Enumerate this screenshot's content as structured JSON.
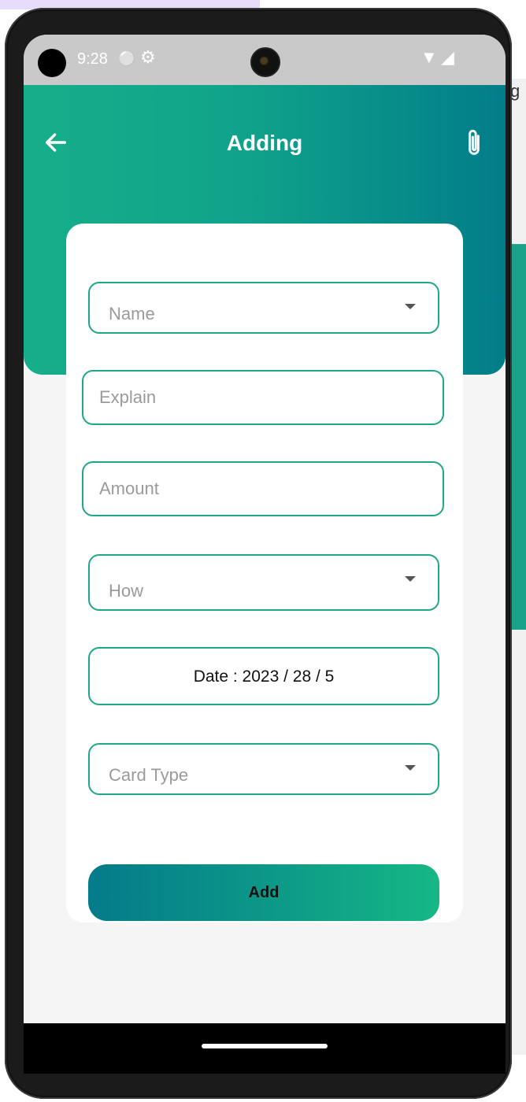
{
  "background": {
    "right_letter": "g"
  },
  "status_bar": {
    "time": "9:28",
    "icons": [
      "usb-icon",
      "settings-icon",
      "wifi-icon",
      "signal-icon"
    ]
  },
  "header": {
    "title": "Adding",
    "back_icon": "arrow-left-icon",
    "attach_icon": "paperclip-icon"
  },
  "form": {
    "name_dropdown": {
      "label": "Name"
    },
    "explain_input": {
      "placeholder": "Explain",
      "value": ""
    },
    "amount_input": {
      "placeholder": "Amount",
      "value": ""
    },
    "how_dropdown": {
      "label": "How"
    },
    "date_button": {
      "label": "Date : 2023 / 28 / 5"
    },
    "card_type_dropdown": {
      "label": "Card Type"
    },
    "add_button": {
      "label": "Add"
    }
  },
  "colors": {
    "accent": "#1ea888",
    "gradient_start": "#16ae8a",
    "gradient_end": "#027d8a"
  }
}
